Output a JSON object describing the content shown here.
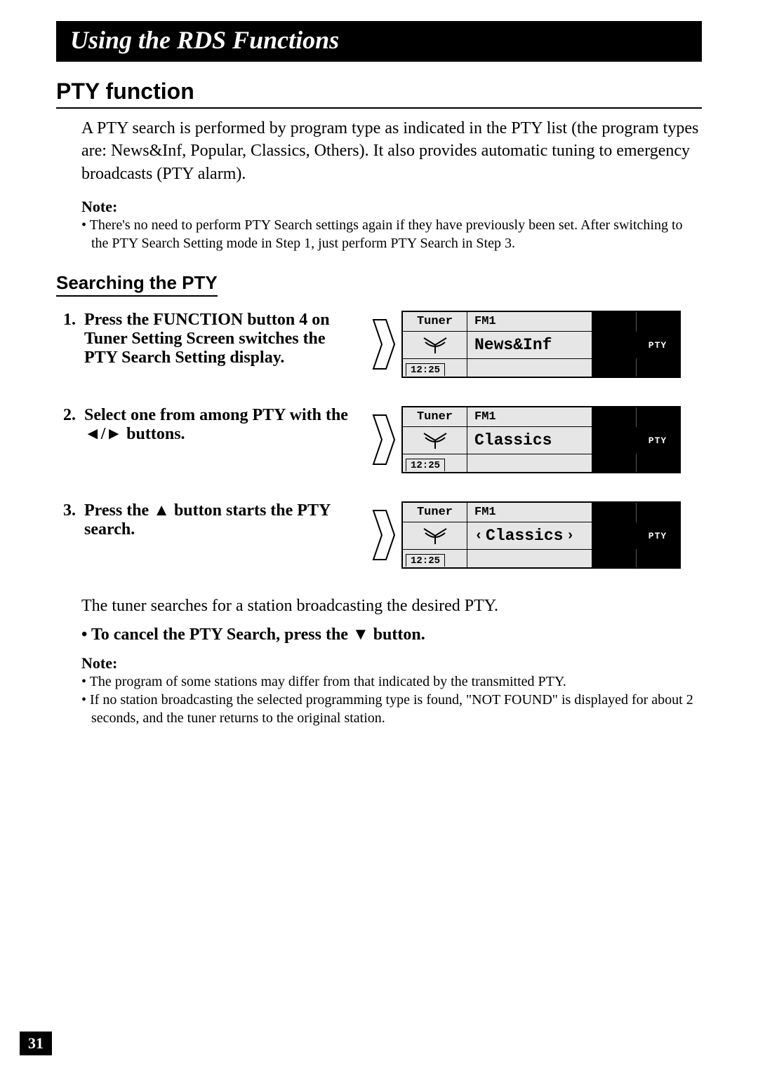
{
  "chapter": "Using the RDS Functions",
  "section": "PTY function",
  "intro": "A PTY search is performed by program type as indicated in the PTY list (the program types are: News&Inf, Popular, Classics, Others). It also provides automatic tuning to emergency broadcasts (PTY alarm).",
  "note1_label": "Note:",
  "note1_items": [
    "There's no need to perform PTY Search settings again if they have previously been set. After switching to the PTY Search Setting mode in Step 1, just perform PTY Search in Step 3."
  ],
  "sub_section": "Searching the PTY",
  "steps": [
    {
      "num": "1.",
      "text": "Press the FUNCTION button 4 on Tuner Setting Screen switches the PTY Search Setting display.",
      "lcd": {
        "tuner": "Tuner",
        "band": "FM1",
        "main": "News&Inf",
        "pty": "PTY",
        "time": "12:25",
        "arrows": false
      }
    },
    {
      "num": "2.",
      "text": "Select one from among PTY with the ◄/► buttons.",
      "lcd": {
        "tuner": "Tuner",
        "band": "FM1",
        "main": "Classics",
        "pty": "PTY",
        "time": "12:25",
        "arrows": false
      }
    },
    {
      "num": "3.",
      "text": "Press the ▲ button starts the PTY search.",
      "lcd": {
        "tuner": "Tuner",
        "band": "FM1",
        "main": "Classics",
        "pty": "PTY",
        "time": "12:25",
        "arrows": true
      }
    }
  ],
  "after_steps": "The tuner searches for a station broadcasting the desired PTY.",
  "cancel": "To cancel the PTY Search, press the ▼ button.",
  "note2_label": "Note:",
  "note2_items": [
    "The program of some stations may differ from that indicated by the transmitted PTY.",
    "If no station broadcasting the selected programming type is found, \"NOT FOUND\" is displayed for about 2 seconds, and the tuner returns to the original station."
  ],
  "page_number": "31"
}
